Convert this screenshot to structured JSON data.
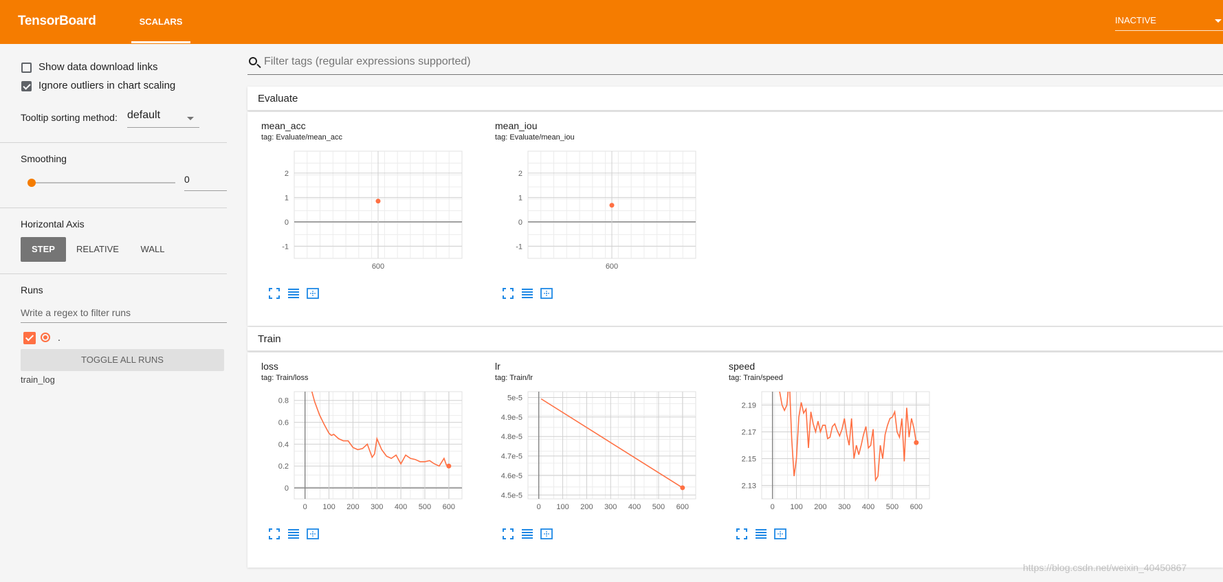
{
  "header": {
    "brand": "TensorBoard",
    "tab": "SCALARS",
    "status": "INACTIVE"
  },
  "sidebar": {
    "show_download": "Show data download links",
    "ignore_outliers": "Ignore outliers in chart scaling",
    "tooltip_label": "Tooltip sorting method:",
    "tooltip_value": "default",
    "smoothing_label": "Smoothing",
    "smoothing_value": "0",
    "smoothing_level": 0,
    "haxis_label": "Horizontal Axis",
    "haxis_options": [
      "STEP",
      "RELATIVE",
      "WALL"
    ],
    "runs_label": "Runs",
    "runs_filter_placeholder": "Write a regex to filter runs",
    "run_name": ".",
    "toggle_all": "TOGGLE ALL RUNS",
    "log_dir": "train_log"
  },
  "filter_placeholder": "Filter tags (regular expressions supported)",
  "categories": [
    {
      "name": "Evaluate"
    },
    {
      "name": "Train"
    }
  ],
  "cards": {
    "mean_acc": {
      "title": "mean_acc",
      "tag": "tag: Evaluate/mean_acc"
    },
    "mean_iou": {
      "title": "mean_iou",
      "tag": "tag: Evaluate/mean_iou"
    },
    "loss": {
      "title": "loss",
      "tag": "tag: Train/loss"
    },
    "lr": {
      "title": "lr",
      "tag": "tag: Train/lr"
    },
    "speed": {
      "title": "speed",
      "tag": "tag: Train/speed"
    }
  },
  "accent_color": "#f57c00",
  "series_color": "#ff7043",
  "watermark": "https://blog.csdn.net/weixin_40450867",
  "chart_data": [
    {
      "id": "mean_acc",
      "type": "scatter",
      "x": [
        600
      ],
      "y": [
        0.85
      ],
      "xticks": [
        "600"
      ],
      "yticks": [
        "2",
        "1",
        "0",
        "-1"
      ],
      "xlim": [
        -300,
        1500
      ],
      "ylim": [
        -1.5,
        2.9
      ],
      "title": "mean_acc"
    },
    {
      "id": "mean_iou",
      "type": "scatter",
      "x": [
        600
      ],
      "y": [
        0.68
      ],
      "xticks": [
        "600"
      ],
      "yticks": [
        "2",
        "1",
        "0",
        "-1"
      ],
      "xlim": [
        -300,
        1500
      ],
      "ylim": [
        -1.5,
        2.9
      ],
      "title": "mean_iou"
    },
    {
      "id": "loss",
      "type": "line",
      "title": "loss",
      "x": [
        20,
        40,
        60,
        80,
        100,
        110,
        120,
        140,
        160,
        180,
        200,
        220,
        240,
        260,
        280,
        290,
        300,
        320,
        340,
        360,
        380,
        400,
        420,
        440,
        460,
        480,
        500,
        520,
        540,
        560,
        580,
        590,
        600
      ],
      "y": [
        0.95,
        0.79,
        0.67,
        0.58,
        0.5,
        0.48,
        0.49,
        0.45,
        0.43,
        0.43,
        0.37,
        0.35,
        0.36,
        0.4,
        0.28,
        0.31,
        0.45,
        0.35,
        0.29,
        0.27,
        0.3,
        0.22,
        0.3,
        0.27,
        0.26,
        0.24,
        0.24,
        0.25,
        0.22,
        0.2,
        0.27,
        0.21,
        0.2
      ],
      "xticks": [
        "0",
        "100",
        "200",
        "300",
        "400",
        "500",
        "600"
      ],
      "yticks": [
        "0.8",
        "0.6",
        "0.4",
        "0.2",
        "0"
      ],
      "xlim": [
        -45,
        655
      ],
      "ylim": [
        -0.1,
        0.88
      ]
    },
    {
      "id": "lr",
      "type": "line",
      "title": "lr",
      "x": [
        10,
        600
      ],
      "y": [
        4.993e-05,
        4.537e-05
      ],
      "xticks": [
        "0",
        "100",
        "200",
        "300",
        "400",
        "500",
        "600"
      ],
      "yticks": [
        "5e-5",
        "4.9e-5",
        "4.8e-5",
        "4.7e-5",
        "4.6e-5",
        "4.5e-5"
      ],
      "xlim": [
        -45,
        655
      ],
      "ylim": [
        4.48e-05,
        5.03e-05
      ]
    },
    {
      "id": "speed",
      "type": "line",
      "title": "speed",
      "x": [
        20,
        30,
        40,
        50,
        60,
        70,
        80,
        90,
        100,
        110,
        120,
        130,
        140,
        150,
        160,
        170,
        180,
        190,
        200,
        210,
        220,
        230,
        240,
        250,
        260,
        270,
        280,
        290,
        300,
        310,
        320,
        330,
        340,
        350,
        360,
        370,
        380,
        390,
        400,
        410,
        420,
        430,
        440,
        450,
        460,
        470,
        480,
        490,
        500,
        510,
        520,
        530,
        540,
        550,
        560,
        570,
        580,
        590,
        600
      ],
      "y": [
        2.21,
        2.2,
        2.19,
        2.186,
        2.19,
        2.21,
        2.165,
        2.137,
        2.15,
        2.181,
        2.192,
        2.184,
        2.187,
        2.158,
        2.185,
        2.176,
        2.17,
        2.178,
        2.17,
        2.175,
        2.175,
        2.165,
        2.166,
        2.174,
        2.176,
        2.171,
        2.167,
        2.172,
        2.18,
        2.168,
        2.16,
        2.18,
        2.15,
        2.16,
        2.153,
        2.16,
        2.168,
        2.174,
        2.158,
        2.16,
        2.172,
        2.134,
        2.137,
        2.16,
        2.15,
        2.168,
        2.175,
        2.18,
        2.181,
        2.185,
        2.17,
        2.166,
        2.18,
        2.148,
        2.188,
        2.166,
        2.18,
        2.173,
        2.162
      ],
      "xticks": [
        "0",
        "100",
        "200",
        "300",
        "400",
        "500",
        "600"
      ],
      "yticks": [
        "2.19",
        "2.17",
        "2.15",
        "2.13"
      ],
      "xlim": [
        -45,
        655
      ],
      "ylim": [
        2.12,
        2.2
      ]
    }
  ]
}
